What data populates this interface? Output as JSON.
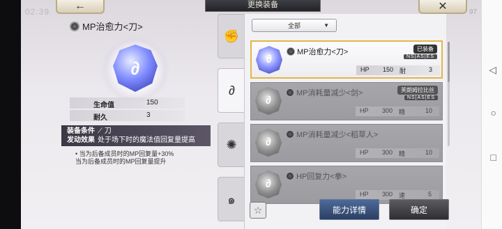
{
  "status": {
    "time": "02:39",
    "battery": "97"
  },
  "header": {
    "title": "更换装备",
    "back_icon": "←",
    "close_icon": "✕"
  },
  "detail": {
    "name": "MP治愈力<刀>",
    "stats": [
      {
        "label": "生命值",
        "value": "150"
      },
      {
        "label": "耐久",
        "value": "3"
      }
    ],
    "condition_label": "装备条件",
    "condition_value": "刀",
    "effect_label": "发动效果",
    "effect_value": "处于场下时的魔法值回复量提高",
    "notes": [
      "• 当为后备成员时的MP回复量+30%",
      "当为后备成员时的MP回复量提升"
    ]
  },
  "tabs": [
    "fist-icon",
    "swirl-icon",
    "burst-icon",
    "wave-icon"
  ],
  "filter": {
    "label": "全部"
  },
  "cards": [
    {
      "name": "MP治愈力<刀>",
      "status": "已装备",
      "tags": "NS|AS|ES",
      "stat1_label": "HP",
      "stat1_value": "150",
      "stat2_label": "耐",
      "stat2_value": "3",
      "selected": true
    },
    {
      "name": "MP消耗量减少<剑>",
      "status": "芙朗姆拉比丝",
      "tags": "NS|AS|ES",
      "stat1_label": "HP",
      "stat1_value": "300",
      "stat2_label": "精",
      "stat2_value": "10"
    },
    {
      "name": "MP消耗量减少<稻草人>",
      "status": "",
      "tags": "",
      "stat1_label": "HP",
      "stat1_value": "300",
      "stat2_label": "精",
      "stat2_value": "10"
    },
    {
      "name": "HP回复力<拳>",
      "status": "",
      "tags": "",
      "stat1_label": "HP",
      "stat1_value": "300",
      "stat2_label": "速",
      "stat2_value": "5"
    }
  ],
  "buttons": {
    "detail": "能力详情",
    "confirm": "确定",
    "favorite": "☆"
  }
}
